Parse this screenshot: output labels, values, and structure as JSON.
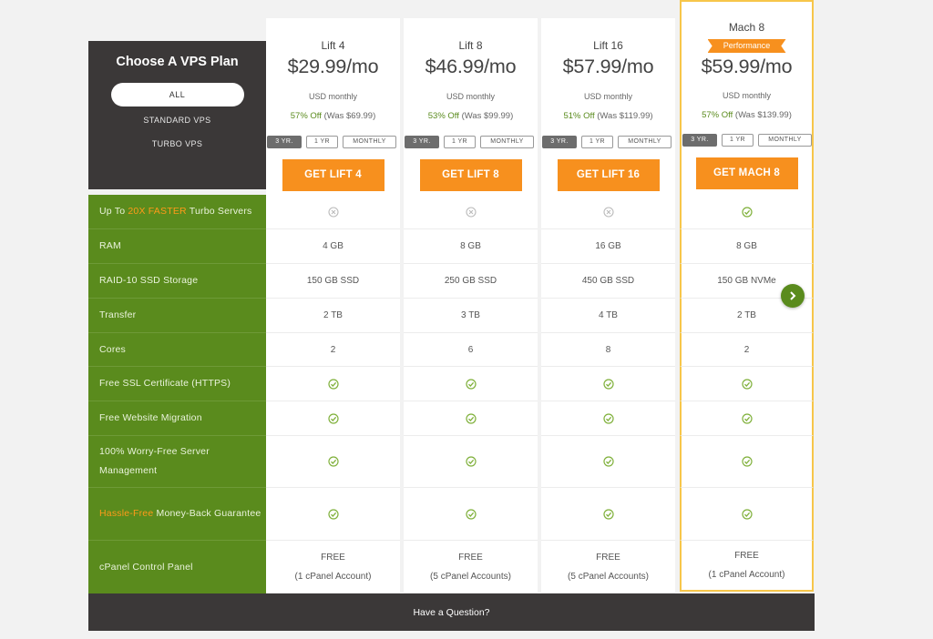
{
  "header": {
    "title": "Choose A VPS Plan",
    "filters": [
      "ALL",
      "STANDARD VPS",
      "TURBO VPS"
    ]
  },
  "features": [
    {
      "pre": "Up To ",
      "hl": "20X FASTER",
      "post": " Turbo Servers"
    },
    {
      "pre": "RAM",
      "hl": "",
      "post": ""
    },
    {
      "pre": "RAID-10 SSD Storage",
      "hl": "",
      "post": ""
    },
    {
      "pre": "Transfer",
      "hl": "",
      "post": ""
    },
    {
      "pre": "Cores",
      "hl": "",
      "post": ""
    },
    {
      "pre": "Free SSL Certificate (HTTPS)",
      "hl": "",
      "post": ""
    },
    {
      "pre": "Free Website Migration",
      "hl": "",
      "post": ""
    },
    {
      "pre": "100% Worry-Free Server Management",
      "hl": "",
      "post": ""
    },
    {
      "pre": "",
      "hl": "Hassle-Free",
      "post": " Money-Back Guarantee"
    },
    {
      "pre": "cPanel Control Panel",
      "hl": "",
      "post": ""
    }
  ],
  "term_labels": {
    "three_year": "3 YR.",
    "one_year": "1 YR",
    "monthly": "MONTHLY"
  },
  "plans": [
    {
      "name": "Lift 4",
      "badge": "",
      "price": "$29.99/mo",
      "period": "USD monthly",
      "discount": "57% Off",
      "was": "(Was $69.99)",
      "cta": "GET LIFT 4",
      "values": [
        "x-icon",
        "4 GB",
        "150 GB SSD",
        "2 TB",
        "2",
        "check-icon",
        "check-icon",
        "check-icon",
        "check-icon",
        [
          "FREE",
          "(1 cPanel Account)"
        ]
      ]
    },
    {
      "name": "Lift 8",
      "badge": "",
      "price": "$46.99/mo",
      "period": "USD monthly",
      "discount": "53% Off",
      "was": "(Was $99.99)",
      "cta": "GET LIFT 8",
      "values": [
        "x-icon",
        "8 GB",
        "250 GB SSD",
        "3 TB",
        "6",
        "check-icon",
        "check-icon",
        "check-icon",
        "check-icon",
        [
          "FREE",
          "(5 cPanel Accounts)"
        ]
      ]
    },
    {
      "name": "Lift 16",
      "badge": "",
      "price": "$57.99/mo",
      "period": "USD monthly",
      "discount": "51% Off",
      "was": "(Was $119.99)",
      "cta": "GET LIFT 16",
      "values": [
        "x-icon",
        "16 GB",
        "450 GB SSD",
        "4 TB",
        "8",
        "check-icon",
        "check-icon",
        "check-icon",
        "check-icon",
        [
          "FREE",
          "(5 cPanel Accounts)"
        ]
      ]
    },
    {
      "name": "Mach 8",
      "badge": "Performance",
      "price": "$59.99/mo",
      "period": "USD monthly",
      "discount": "57% Off",
      "was": "(Was $139.99)",
      "cta": "GET MACH 8",
      "values": [
        "check-icon",
        "8 GB",
        "150 GB NVMe",
        "2 TB",
        "2",
        "check-icon",
        "check-icon",
        "check-icon",
        "check-icon",
        [
          "FREE",
          "(1 cPanel Account)"
        ]
      ]
    }
  ],
  "footer": {
    "question": "Have a Question?"
  },
  "colors": {
    "accent": "#f7901e",
    "green": "#5a8b1d",
    "dark": "#3b3838",
    "featured_border": "#f7c64a"
  }
}
